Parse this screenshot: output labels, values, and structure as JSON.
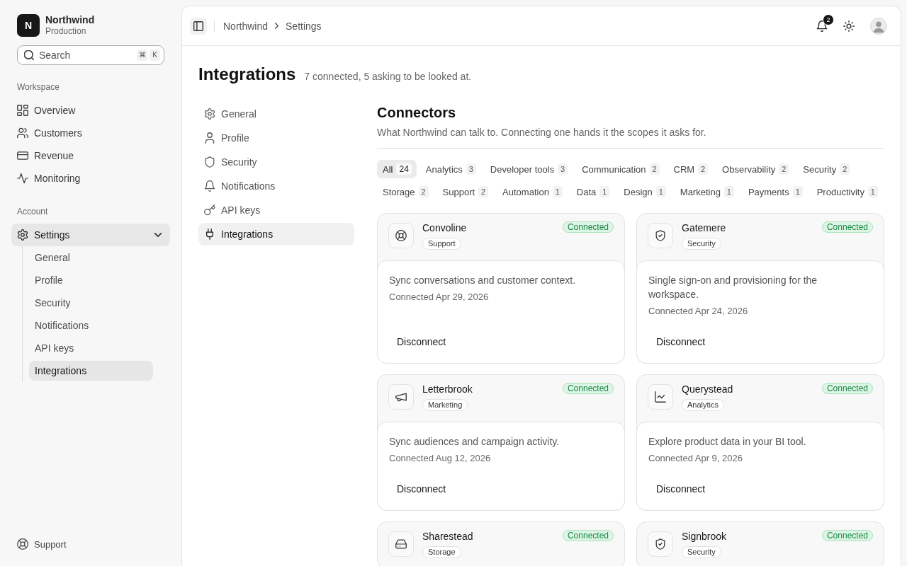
{
  "sidebar": {
    "brand": {
      "logo_letter": "N",
      "name": "Northwind",
      "environment": "Production"
    },
    "search": {
      "placeholder": "Search",
      "shortcut": [
        "⌘",
        "K"
      ]
    },
    "sections": [
      {
        "title": "Workspace",
        "items": [
          {
            "label": "Overview",
            "selected": false
          },
          {
            "label": "Customers",
            "selected": false
          },
          {
            "label": "Revenue",
            "selected": false
          },
          {
            "label": "Monitoring",
            "selected": false
          }
        ]
      },
      {
        "title": "Account",
        "items": [
          {
            "label": "Settings",
            "selected": true,
            "expanded": true,
            "children": [
              {
                "label": "General",
                "selected": false
              },
              {
                "label": "Profile",
                "selected": false
              },
              {
                "label": "Security",
                "selected": false
              },
              {
                "label": "Notifications",
                "selected": false
              },
              {
                "label": "API keys",
                "selected": false
              },
              {
                "label": "Integrations",
                "selected": true
              }
            ]
          }
        ]
      }
    ],
    "footer_link": "Support"
  },
  "header": {
    "breadcrumb": [
      "Northwind",
      "Settings"
    ],
    "notification_count": "2"
  },
  "page": {
    "title": "Integrations",
    "summary": "7 connected, 5 asking to be looked at."
  },
  "settings_nav": [
    {
      "label": "General",
      "selected": false
    },
    {
      "label": "Profile",
      "selected": false
    },
    {
      "label": "Security",
      "selected": false
    },
    {
      "label": "Notifications",
      "selected": false
    },
    {
      "label": "API keys",
      "selected": false
    },
    {
      "label": "Integrations",
      "selected": true
    }
  ],
  "connectors": {
    "title": "Connectors",
    "description": "What Northwind can talk to. Connecting one hands it the scopes it asks for.",
    "filters": [
      {
        "label": "All",
        "count": "24",
        "selected": true
      },
      {
        "label": "Analytics",
        "count": "3",
        "selected": false
      },
      {
        "label": "Developer tools",
        "count": "3",
        "selected": false
      },
      {
        "label": "Communication",
        "count": "2",
        "selected": false
      },
      {
        "label": "CRM",
        "count": "2",
        "selected": false
      },
      {
        "label": "Observability",
        "count": "2",
        "selected": false
      },
      {
        "label": "Security",
        "count": "2",
        "selected": false
      },
      {
        "label": "Storage",
        "count": "2",
        "selected": false
      },
      {
        "label": "Support",
        "count": "2",
        "selected": false
      },
      {
        "label": "Automation",
        "count": "1",
        "selected": false
      },
      {
        "label": "Data",
        "count": "1",
        "selected": false
      },
      {
        "label": "Design",
        "count": "1",
        "selected": false
      },
      {
        "label": "Marketing",
        "count": "1",
        "selected": false
      },
      {
        "label": "Payments",
        "count": "1",
        "selected": false
      },
      {
        "label": "Productivity",
        "count": "1",
        "selected": false
      }
    ],
    "cards": [
      {
        "kind": "support",
        "name": "Convoline",
        "category": "Support",
        "status": "Connected",
        "description": "Sync conversations and customer context.",
        "connected_on": "Connected Apr 29, 2026",
        "action": "Disconnect"
      },
      {
        "kind": "security",
        "name": "Gatemere",
        "category": "Security",
        "status": "Connected",
        "description": "Single sign-on and provisioning for the workspace.",
        "connected_on": "Connected Apr 24, 2026",
        "action": "Disconnect"
      },
      {
        "kind": "marketing",
        "name": "Letterbrook",
        "category": "Marketing",
        "status": "Connected",
        "description": "Sync audiences and campaign activity.",
        "connected_on": "Connected Aug 12, 2026",
        "action": "Disconnect"
      },
      {
        "kind": "analytics",
        "name": "Querystead",
        "category": "Analytics",
        "status": "Connected",
        "description": "Explore product data in your BI tool.",
        "connected_on": "Connected Apr 9, 2026",
        "action": "Disconnect"
      },
      {
        "kind": "storage",
        "name": "Sharestead",
        "category": "Storage",
        "status": "Connected"
      },
      {
        "kind": "security",
        "name": "Signbrook",
        "category": "Security",
        "status": "Connected"
      }
    ]
  }
}
